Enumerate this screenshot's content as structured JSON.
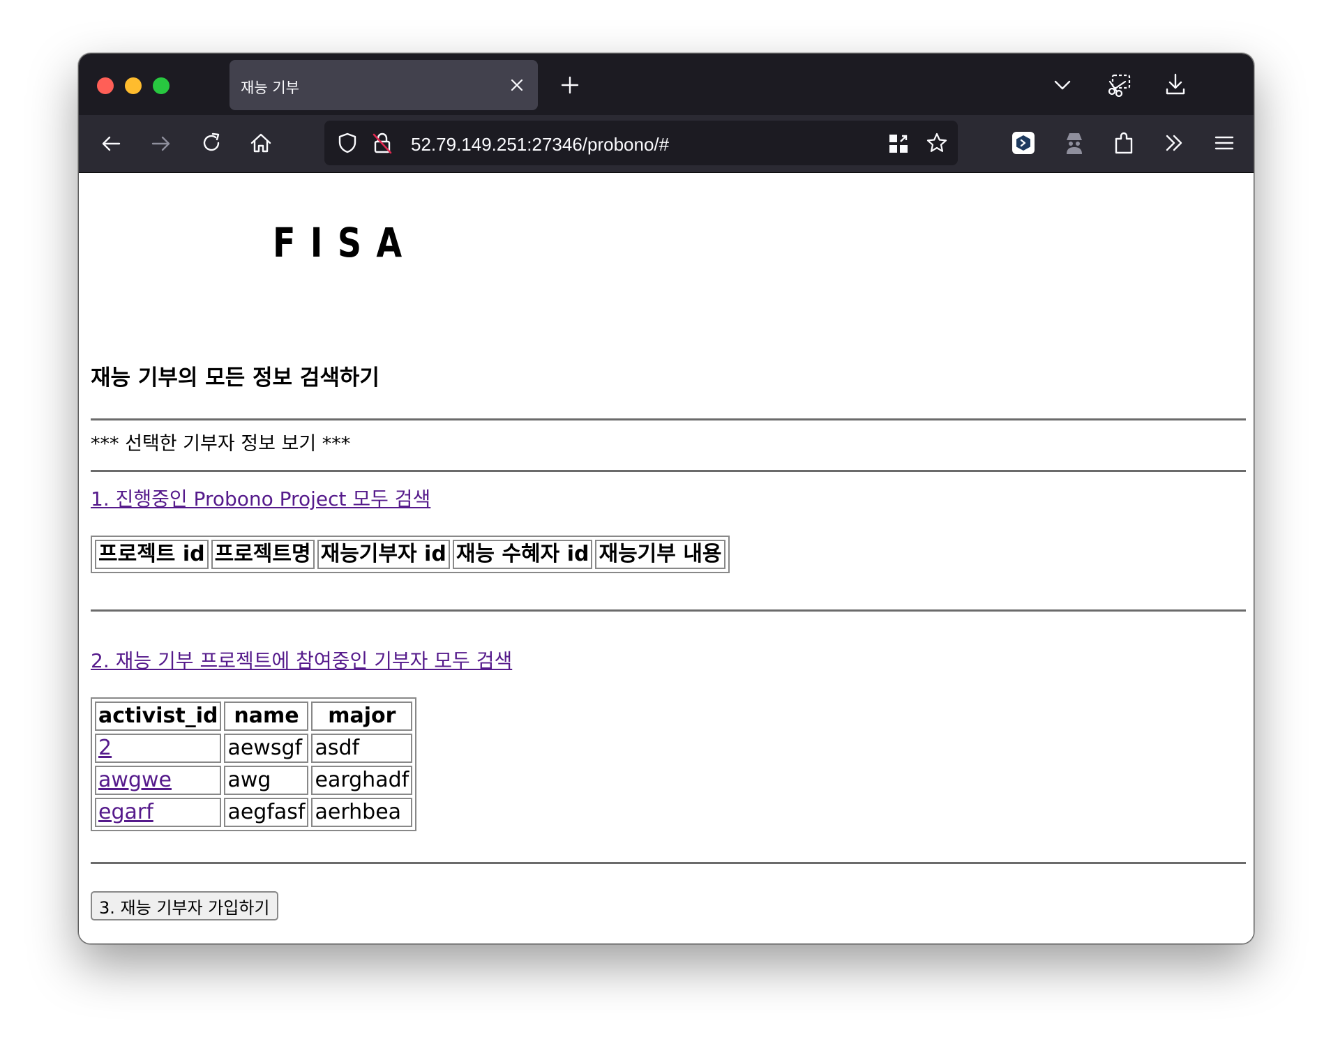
{
  "browser": {
    "tab_title": "재능 기부",
    "url": "52.79.149.251:27346/probono/#"
  },
  "page": {
    "logo": "FISA",
    "title": "재능 기부의 모든 정보 검색하기",
    "selected_donor_text": "*** 선택한 기부자 정보 보기 ***",
    "link1": "1. 진행중인 Probono Project 모두 검색",
    "table1": {
      "headers": [
        "프로젝트 id",
        "프로젝트명",
        "재능기부자 id",
        "재능 수혜자 id",
        "재능기부 내용"
      ]
    },
    "link2": "2. 재능 기부 프로젝트에 참여중인 기부자 모두 검색",
    "table2": {
      "headers": [
        "activist_id",
        "name",
        "major"
      ],
      "rows": [
        {
          "activist_id": "2",
          "name": "aewsgf",
          "major": "asdf"
        },
        {
          "activist_id": "awgwe",
          "name": "awg",
          "major": "earghadf"
        },
        {
          "activist_id": "egarf",
          "name": "aegfasf",
          "major": "aerhbea"
        }
      ]
    },
    "signup_button": "3. 재능 기부자 가입하기"
  }
}
